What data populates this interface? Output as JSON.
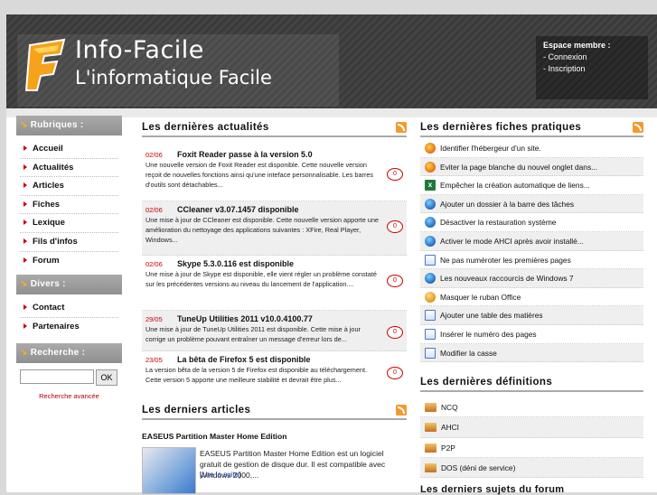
{
  "header": {
    "brand": "Info-Facile",
    "slogan": "L'informatique Facile",
    "member": {
      "title": "Espace membre :",
      "links": [
        "- Connexion",
        "- Inscription"
      ]
    }
  },
  "sidebar": {
    "rubriques": {
      "title": "Rubriques :",
      "items": [
        "Accueil",
        "Actualités",
        "Articles",
        "Fiches",
        "Lexique",
        "Fils d'infos",
        "Forum"
      ]
    },
    "divers": {
      "title": "Divers :",
      "items": [
        "Contact",
        "Partenaires"
      ]
    },
    "recherche": {
      "title": "Recherche :",
      "input_value": "",
      "ok_label": "OK",
      "advanced": "Recherche avancée"
    }
  },
  "news": {
    "title": "Les dernières actualités",
    "items": [
      {
        "date": "02/06",
        "title": "Foxit Reader passe à la version 5.0",
        "desc": "Une nouvelle version de Foxit Reader est disponible. Cette nouvelle version reçoit de nouvelles fonctions ainsi qu'une inteface personnalisable. Les barres d'outils sont détachables...",
        "comments": "0"
      },
      {
        "date": "02/06",
        "title": "CCleaner v3.07.1457 disponible",
        "desc": "Une mise à jour de CCleaner est disponible. Cette nouvelle version apporte une amélioration du nettoyage des applications suivantes : XFire, Real Player, Windows...",
        "comments": "0"
      },
      {
        "date": "02/06",
        "title": "Skype 5.3.0.116 est disponible",
        "desc": "Une mise à jour de Skype est disponible, elle vient régler un problème constaté sur les précédentes versions au niveau du lancement de l'application....",
        "comments": "0"
      },
      {
        "date": "29/05",
        "title": "TuneUp Utilities 2011 v10.0.4100.77",
        "desc": "Une mise à jour de TuneUp Utilities 2011 est disponible. Cette mise à jour corrige un problème pouvant entraîner un message d'erreur lors de...",
        "comments": "0"
      },
      {
        "date": "23/05",
        "title": "La bêta de Firefox 5 est disponible",
        "desc": "La version bêta de la version 5 de Firefox est disponible au téléchargement. Cette version 5 apporte une meilleure stabilité et devrait être plus...",
        "comments": "0"
      }
    ]
  },
  "articles": {
    "title": "Les derniers articles",
    "item_title": "EASEUS Partition Master Home Edition",
    "item_desc": "EASEUS Partition Master Home Edition est un logiciel gratuit de gestion de disque dur. Il est compatible avec Windows 2000,...",
    "more": "[Lire la suite]"
  },
  "fiches": {
    "title": "Les dernières fiches pratiques",
    "items": [
      {
        "icon": "firefox-icon",
        "label": "Identifier l'hébergeur d'un site."
      },
      {
        "icon": "firefox-icon",
        "label": "Eviter la page blanche du nouvel onglet dans..."
      },
      {
        "icon": "excel-icon",
        "label": "Empêcher la création automatique de liens..."
      },
      {
        "icon": "windows-icon",
        "label": "Ajouter un dossier à la barre des tâches"
      },
      {
        "icon": "windows-icon",
        "label": "Désactiver la restauration système"
      },
      {
        "icon": "windows-icon",
        "label": "Activer le mode AHCI après avoir installé..."
      },
      {
        "icon": "word-icon",
        "label": "Ne pas numéroter les premières pages"
      },
      {
        "icon": "windows-icon",
        "label": "Les nouveaux raccourcis de Windows 7"
      },
      {
        "icon": "office-icon",
        "label": "Masquer le ruban Office"
      },
      {
        "icon": "word-icon",
        "label": "Ajouter une table des matières"
      },
      {
        "icon": "word-icon",
        "label": "Insérer le numéro des pages"
      },
      {
        "icon": "word-icon",
        "label": "Modifier la casse"
      }
    ]
  },
  "definitions": {
    "title": "Les dernières définitions",
    "items": [
      "NCQ",
      "AHCI",
      "P2P",
      "DOS (déni de service)"
    ]
  },
  "forum": {
    "title": "Les derniers sujets du forum"
  },
  "colors": {
    "accent": "#c30000",
    "header_bg": "#3c3c3c",
    "block_head": "#9a9a9a"
  }
}
